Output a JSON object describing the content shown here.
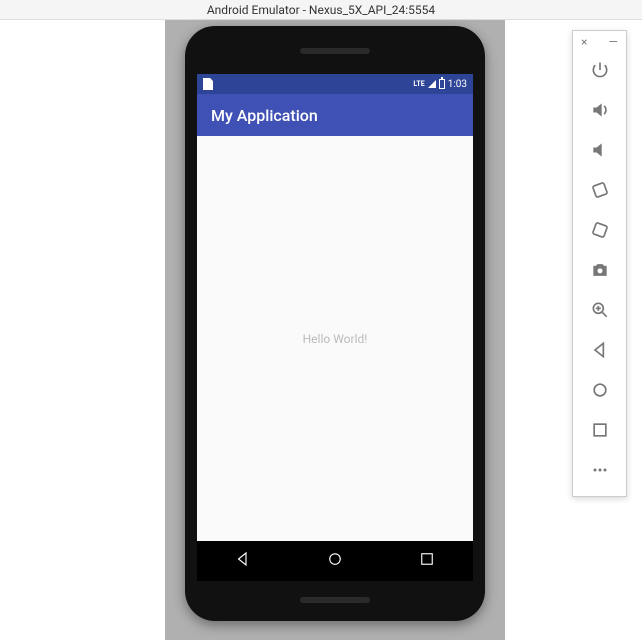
{
  "window": {
    "title": "Android Emulator - Nexus_5X_API_24:5554"
  },
  "statusbar": {
    "lte": "LTE",
    "time": "1:03"
  },
  "app": {
    "title": "My Application",
    "content_text": "Hello World!"
  },
  "toolbar": {
    "close": "×",
    "minimize": "—"
  }
}
